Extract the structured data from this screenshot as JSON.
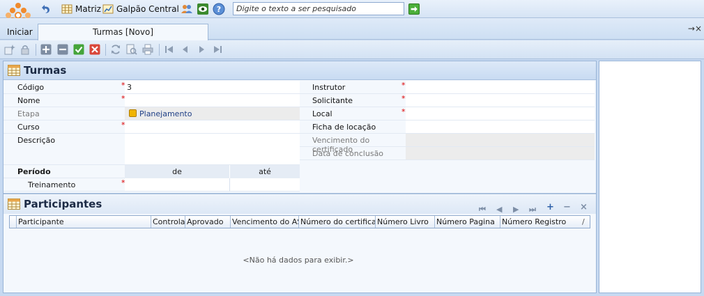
{
  "topbar": {
    "matriz_label": "Matriz",
    "galpao_label": "Galpão Central",
    "search_placeholder": "Digite o texto a ser pesquisado"
  },
  "tabs": {
    "iniciar_label": "Iniciar",
    "active_tab": "Turmas [Novo]",
    "close_glyph": "→×"
  },
  "form": {
    "title": "Turmas",
    "left_fields": [
      {
        "label": "Código",
        "value": "3",
        "required": "*"
      },
      {
        "label": "Nome",
        "value": "",
        "required": "*"
      },
      {
        "label": "Etapa",
        "value": "Planejamento",
        "required": ""
      },
      {
        "label": "Curso",
        "value": "",
        "required": "*"
      },
      {
        "label": "Descrição",
        "value": "",
        "required": ""
      }
    ],
    "right_fields": [
      {
        "label": "Instrutor",
        "value": "",
        "required": "*"
      },
      {
        "label": "Solicitante",
        "value": "",
        "required": "*"
      },
      {
        "label": "Local",
        "value": "",
        "required": "*"
      },
      {
        "label": "Ficha de locação",
        "value": "",
        "required": ""
      },
      {
        "label": "Vencimento do certificado",
        "value": "",
        "required": ""
      },
      {
        "label": "Data de conclusão",
        "value": "",
        "required": ""
      }
    ],
    "periodo": {
      "label": "Período",
      "de_header": "de",
      "ate_header": "até",
      "treinamento_label": "Treinamento",
      "required": "*",
      "de_value": "",
      "ate_value": ""
    }
  },
  "participantes": {
    "title": "Participantes",
    "columns": [
      "Participante",
      "Controlar",
      "Aprovado",
      "Vencimento do ASO",
      "Número do certificado",
      "Número Livro",
      "Número Pagina",
      "Número Registro"
    ],
    "empty_message": "<Não há dados para exibir.>",
    "nav_glyphs": [
      "⏮",
      "◀",
      "▶",
      "⏭",
      "+",
      "−",
      "×"
    ]
  },
  "colors": {
    "accent": "#c6d9f1",
    "required": "#dd0000",
    "etapa_badge": "#f0b400"
  }
}
